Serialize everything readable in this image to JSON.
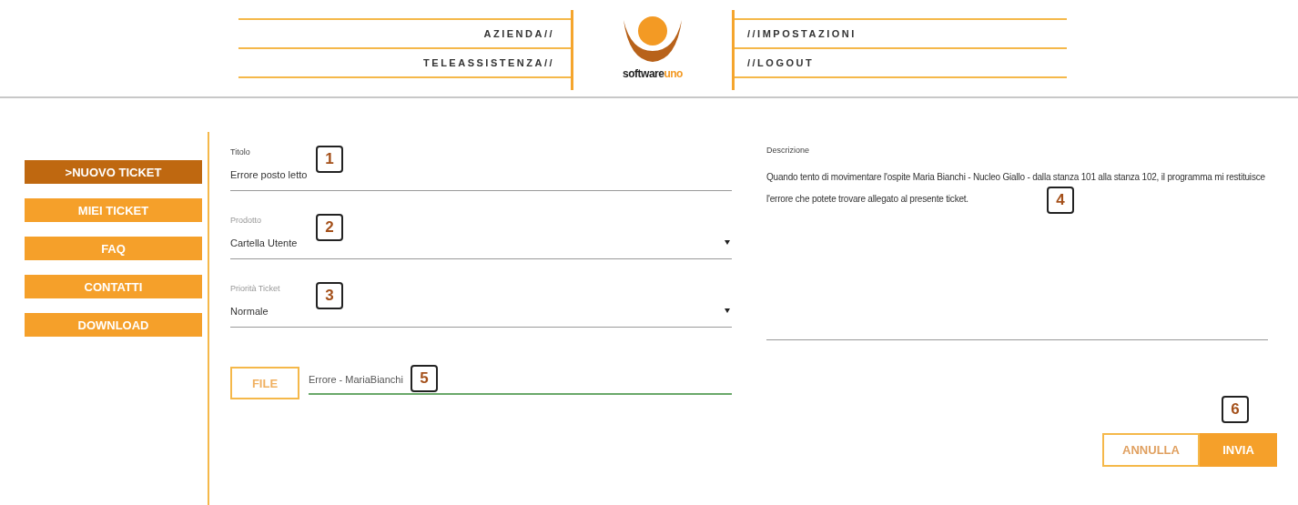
{
  "header": {
    "left_links": [
      "AZIENDA//",
      "TELEASSISTENZA//"
    ],
    "logo_words": [
      "software",
      "uno"
    ],
    "right_links": [
      "//IMPOSTAZIONI",
      "//LOGOUT"
    ]
  },
  "sidebar": {
    "items": [
      {
        "label": ">NUOVO TICKET",
        "selected": true
      },
      {
        "label": "MIEI TICKET",
        "selected": false
      },
      {
        "label": "FAQ",
        "selected": false
      },
      {
        "label": "CONTATTI",
        "selected": false
      },
      {
        "label": "DOWNLOAD",
        "selected": false
      }
    ]
  },
  "form": {
    "fields": [
      {
        "kind": "text",
        "label": "Titolo",
        "value": "Errore posto letto",
        "callout": "1"
      },
      {
        "kind": "select",
        "label": "Prodotto",
        "value": "Cartella Utente",
        "callout": "2"
      },
      {
        "kind": "select",
        "label": "Priorità Ticket",
        "value": "Normale",
        "callout": "3"
      }
    ],
    "attachment": {
      "button": "FILE",
      "filename": "Errore - MariaBianchi",
      "callout": "5"
    }
  },
  "description": {
    "label": "Descrizione",
    "value": "Quando tento di movimentare l'ospite Maria Bianchi - Nucleo Giallo - dalla stanza 101 alla stanza 102, il programma mi restituisce l'errore che potete trovare allegato al presente ticket.",
    "callout": "4"
  },
  "actions": [
    {
      "kind": "secondary",
      "label": "ANNULLA"
    },
    {
      "kind": "primary",
      "label": "INVIA",
      "callout": "6"
    }
  ]
}
